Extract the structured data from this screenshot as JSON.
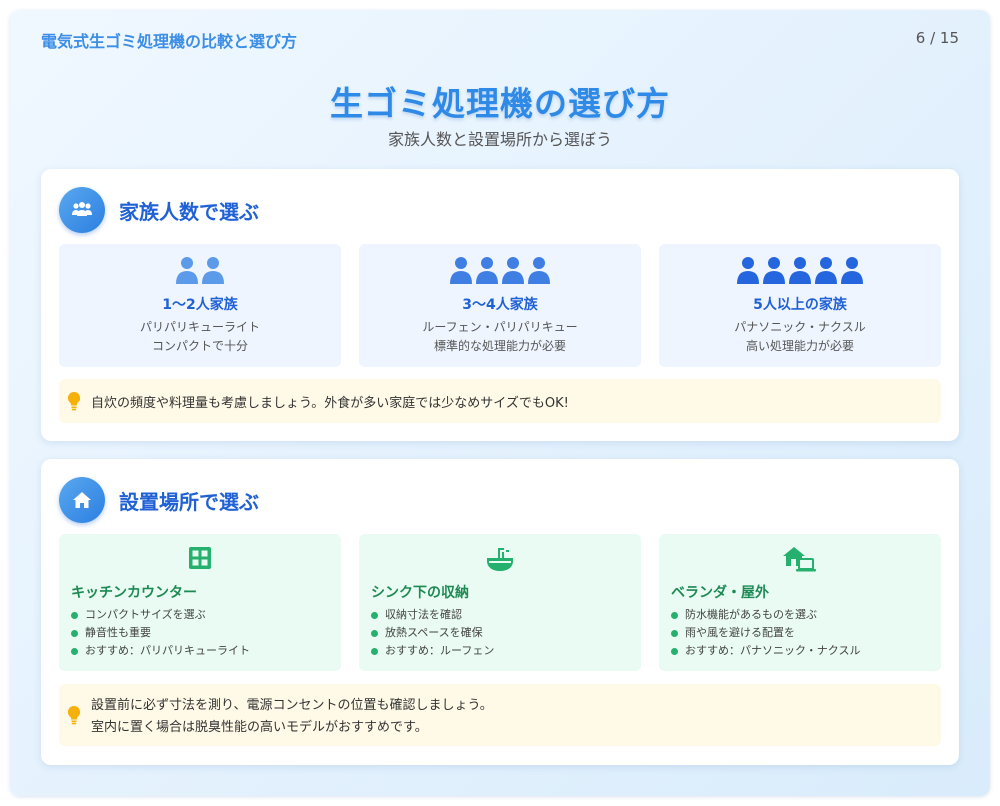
{
  "header": {
    "title": "電気式生ゴミ処理機の比較と選び方",
    "page": "6 / 15"
  },
  "main": {
    "title": "生ゴミ処理機の選び方",
    "subtitle": "家族人数と設置場所から選ぼう"
  },
  "family_section": {
    "title": "家族人数で選ぶ",
    "icon": "users-icon",
    "options": [
      {
        "label": "1〜2人家族",
        "line1": "パリパリキューライト",
        "line2": "コンパクトで十分",
        "people": 2,
        "color": "#5b9bea"
      },
      {
        "label": "3〜4人家族",
        "line1": "ルーフェン・パリパリキュー",
        "line2": "標準的な処理能力が必要",
        "people": 4,
        "color": "#3f7fe3"
      },
      {
        "label": "5人以上の家族",
        "line1": "パナソニック・ナクスル",
        "line2": "高い処理能力が必要",
        "people": 5,
        "color": "#2565de"
      }
    ],
    "tip": "自炊の頻度や料理量も考慮しましょう。外食が多い家庭では少なめサイズでもOK!"
  },
  "location_section": {
    "title": "設置場所で選ぶ",
    "icon": "home-icon",
    "options": [
      {
        "icon": "grid-icon",
        "title": "キッチンカウンター",
        "items": [
          "コンパクトサイズを選ぶ",
          "静音性も重要",
          "おすすめ：パリパリキューライト"
        ]
      },
      {
        "icon": "sink-icon",
        "title": "シンク下の収納",
        "items": [
          "収納寸法を確認",
          "放熱スペースを確保",
          "おすすめ：ルーフェン"
        ]
      },
      {
        "icon": "house-laptop-icon",
        "title": "ベランダ・屋外",
        "items": [
          "防水機能があるものを選ぶ",
          "雨や風を避ける配置を",
          "おすすめ：パナソニック・ナクスル"
        ]
      }
    ],
    "tip_line1": "設置前に必ず寸法を測り、電源コンセントの位置も確認しましょう。",
    "tip_line2": "室内に置く場合は脱臭性能の高いモデルがおすすめです。"
  },
  "colors": {
    "accent": "#2e8ae6",
    "heading": "#2161d6",
    "green": "#1d8a54",
    "tip_bg": "#fff9e7",
    "bulb": "#f5b10a"
  }
}
